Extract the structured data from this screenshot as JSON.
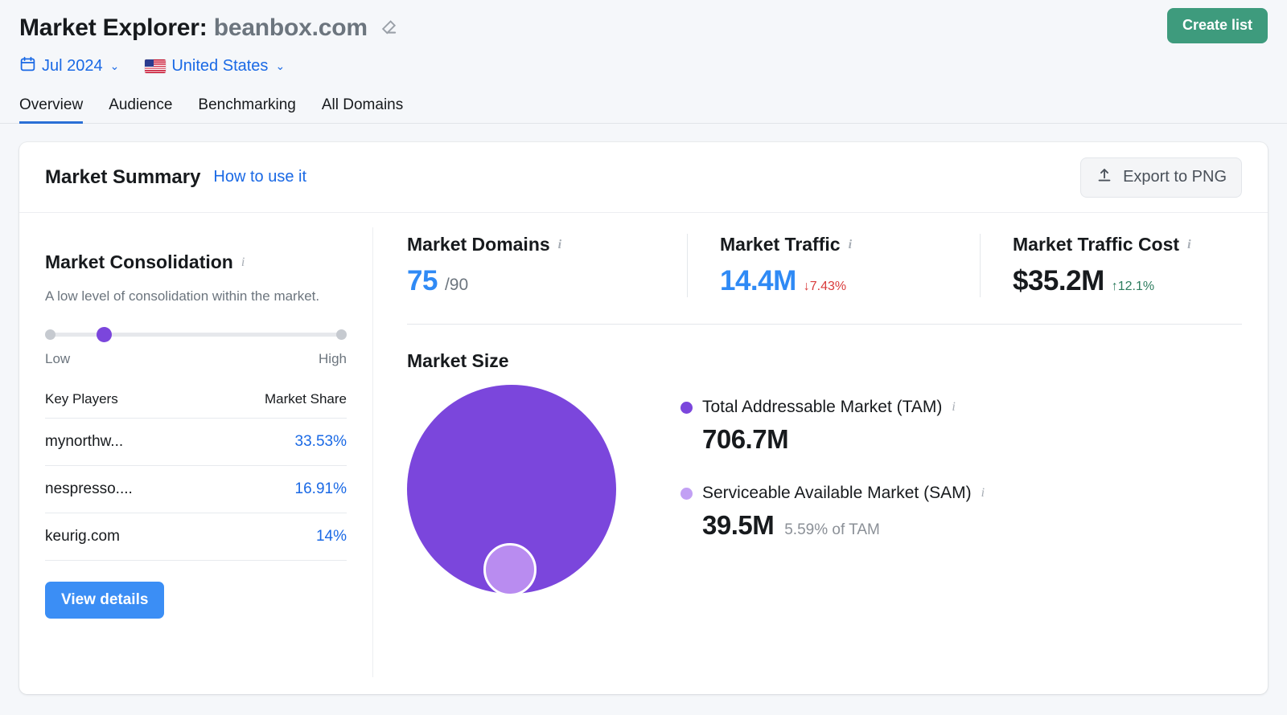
{
  "header": {
    "title_prefix": "Market Explorer:",
    "domain": "beanbox.com",
    "edit_icon": "pencil-icon",
    "create_list_label": "Create list",
    "date_filter": "Jul 2024",
    "country_filter": "United States",
    "calendar_icon": "calendar-icon",
    "flag_icon": "us-flag-icon",
    "chevron": "⌄"
  },
  "tabs": [
    {
      "label": "Overview",
      "active": true
    },
    {
      "label": "Audience",
      "active": false
    },
    {
      "label": "Benchmarking",
      "active": false
    },
    {
      "label": "All Domains",
      "active": false
    }
  ],
  "card": {
    "title": "Market Summary",
    "how_to_use": "How to use it",
    "export_label": "Export to PNG",
    "export_icon": "upload-icon"
  },
  "consolidation": {
    "title": "Market Consolidation",
    "info_icon": "info-icon",
    "description": "A low level of consolidation within the market.",
    "slider": {
      "low_label": "Low",
      "high_label": "High",
      "position_percent": 17
    },
    "table": {
      "columns": [
        "Key Players",
        "Market Share"
      ],
      "rows": [
        {
          "player": "mynorthw...",
          "share": "33.53%"
        },
        {
          "player": "nespresso....",
          "share": "16.91%"
        },
        {
          "player": "keurig.com",
          "share": "14%"
        }
      ]
    },
    "view_details_label": "View details"
  },
  "metrics": [
    {
      "label": "Market Domains",
      "info_icon": "info-icon",
      "value": "75",
      "suffix": "/90",
      "delta": "",
      "delta_dir": ""
    },
    {
      "label": "Market Traffic",
      "info_icon": "info-icon",
      "value": "14.4M",
      "suffix": "",
      "delta": "↓7.43%",
      "delta_dir": "down"
    },
    {
      "label": "Market Traffic Cost",
      "info_icon": "info-icon",
      "value": "$35.2M",
      "suffix": "",
      "delta": "↑12.1%",
      "delta_dir": "up"
    }
  ],
  "market_size": {
    "title": "Market Size",
    "tam": {
      "label": "Total Addressable Market (TAM)",
      "value": "706.7M",
      "sub": "",
      "color": "#7b46dc",
      "info_icon": "info-icon"
    },
    "sam": {
      "label": "Serviceable Available Market (SAM)",
      "value": "39.5M",
      "sub": "5.59% of TAM",
      "color": "#c2a0f4",
      "info_icon": "info-icon"
    }
  },
  "chart_data": {
    "type": "bubble",
    "title": "Market Size",
    "series": [
      {
        "name": "Total Addressable Market (TAM)",
        "value": 706700000,
        "display": "706.7M",
        "color": "#7b46dc",
        "radius_px": 130
      },
      {
        "name": "Serviceable Available Market (SAM)",
        "value": 39500000,
        "display": "39.5M",
        "color": "#b98cf0",
        "radius_px": 33,
        "percent_of_tam": 5.59
      }
    ],
    "legend_position": "right",
    "grid": false
  },
  "colors": {
    "accent_blue": "#1a69e5",
    "button_blue": "#3b8ef5",
    "button_green": "#3e9b7d",
    "purple": "#7b46dc",
    "light_purple": "#c2a0f4",
    "red": "#d93c3c",
    "green": "#2e7d5f",
    "page_bg": "#f5f7fa"
  }
}
